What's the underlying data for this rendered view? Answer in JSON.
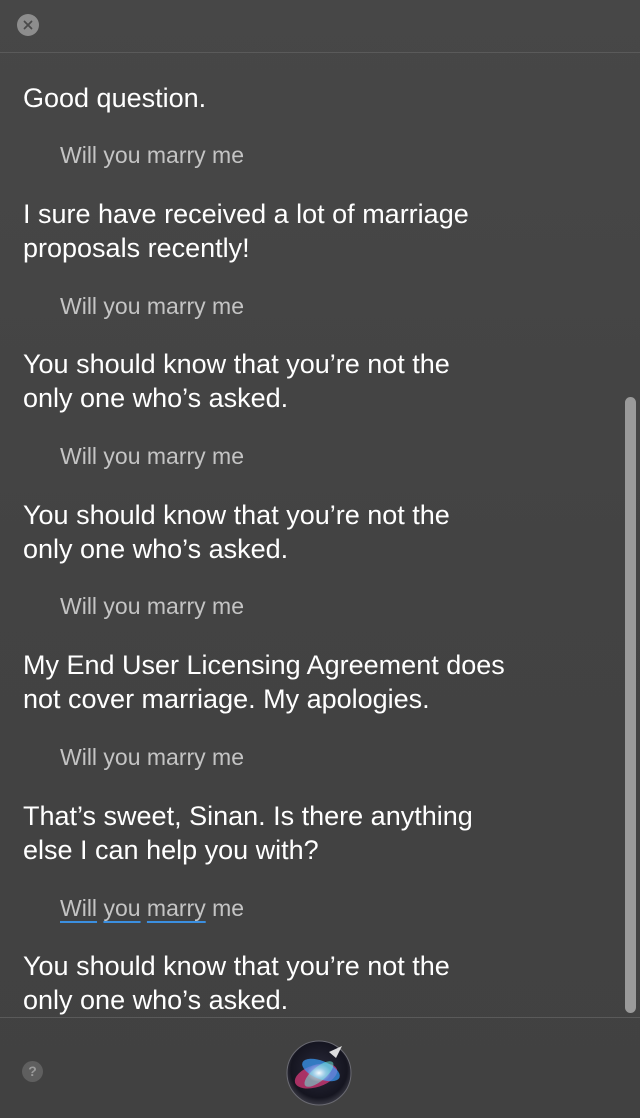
{
  "window": {
    "close_icon": "close-icon",
    "help_label": "?",
    "siri_icon": "siri-orb-icon"
  },
  "conversation": [
    {
      "role": "siri",
      "lines": [
        "Good question."
      ]
    },
    {
      "role": "user",
      "text": "Will you marry me"
    },
    {
      "role": "siri",
      "lines": [
        "I sure have received a lot of marriage",
        "proposals recently!"
      ]
    },
    {
      "role": "user",
      "text": "Will you marry me"
    },
    {
      "role": "siri",
      "lines": [
        "You should know that you’re not the",
        "only one who’s asked."
      ]
    },
    {
      "role": "user",
      "text": "Will you marry me"
    },
    {
      "role": "siri",
      "lines": [
        "You should know that you’re not the",
        "only one who’s asked."
      ]
    },
    {
      "role": "user",
      "text": "Will you marry me"
    },
    {
      "role": "siri",
      "lines": [
        "My End User Licensing Agreement does",
        "not cover marriage. My apologies."
      ]
    },
    {
      "role": "user",
      "text": "Will you marry me"
    },
    {
      "role": "siri",
      "lines": [
        "That’s sweet, Sinan. Is there anything",
        "else I can help you with?"
      ]
    },
    {
      "role": "user",
      "words": [
        "Will",
        "you",
        "marry",
        "me"
      ]
    },
    {
      "role": "siri",
      "lines": [
        "You should know that you’re not the",
        "only one who’s asked."
      ]
    }
  ],
  "colors": {
    "background": "#444444",
    "siri_text": "#ffffff",
    "user_text": "#c4c4c4",
    "spellcheck_underline": "#3b8fe0"
  }
}
